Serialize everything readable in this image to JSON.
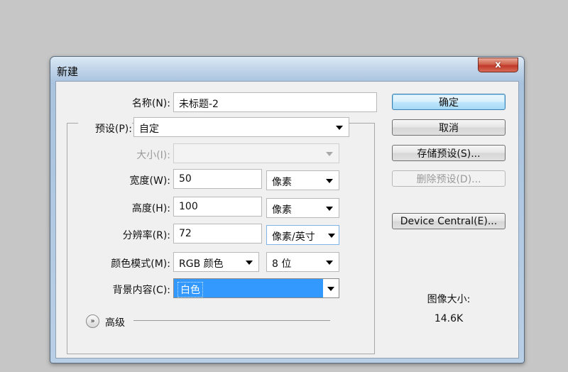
{
  "dialog": {
    "title": "新建",
    "close_glyph": "x"
  },
  "form": {
    "name": {
      "label": "名称(N):",
      "value": "未标题-2"
    },
    "preset": {
      "label": "预设(P):",
      "value": "自定"
    },
    "size": {
      "label": "大小(I):",
      "value": ""
    },
    "width": {
      "label": "宽度(W):",
      "value": "50",
      "unit": "像素"
    },
    "height": {
      "label": "高度(H):",
      "value": "100",
      "unit": "像素"
    },
    "resolution": {
      "label": "分辨率(R):",
      "value": "72",
      "unit": "像素/英寸"
    },
    "color_mode": {
      "label": "颜色模式(M):",
      "mode": "RGB 颜色",
      "bits": "8 位"
    },
    "background": {
      "label": "背景内容(C):",
      "value": "白色"
    },
    "advanced": {
      "label": "高级"
    }
  },
  "buttons": {
    "ok": "确定",
    "cancel": "取消",
    "save_preset": "存储预设(S)...",
    "delete_preset": "删除预设(D)...",
    "device_central": "Device Central(E)..."
  },
  "image_size": {
    "label": "图像大小:",
    "value": "14.6K"
  },
  "colors": {
    "selection_blue": "#3399ff",
    "default_button_border": "#3c7fb1",
    "close_red": "#c0392b"
  }
}
